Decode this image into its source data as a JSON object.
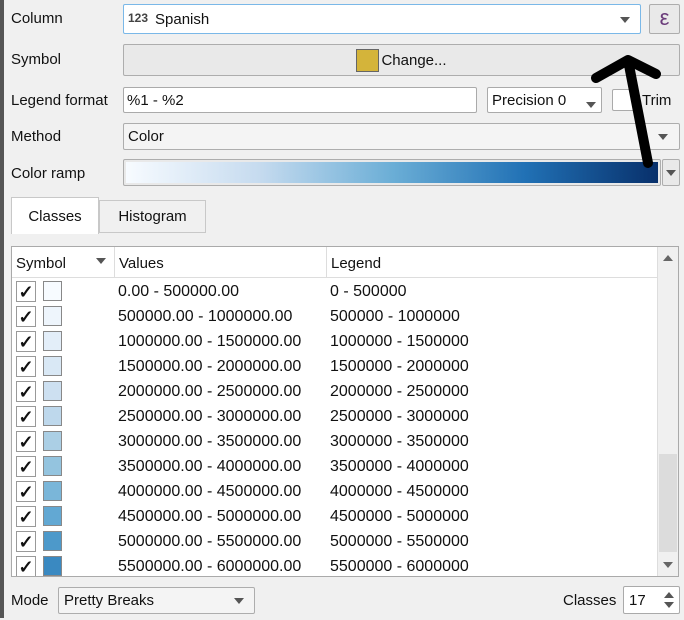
{
  "form": {
    "column_label": "Column",
    "column_type": "123",
    "column_value": "Spanish",
    "symbol_label": "Symbol",
    "symbol_button": "Change...",
    "symbol_color": "#d4b43a",
    "legend_format_label": "Legend format",
    "legend_format_value": "%1 - %2",
    "precision": "Precision 0",
    "trim_label": "Trim",
    "method_label": "Method",
    "method_value": "Color",
    "color_ramp_label": "Color ramp",
    "color_ramp_colors": [
      "#f7fbff",
      "#c6dbef",
      "#6baed6",
      "#2171b5",
      "#08306b"
    ],
    "expression_icon": "ε"
  },
  "tabs": [
    {
      "label": "Classes",
      "active": true
    },
    {
      "label": "Histogram",
      "active": false
    }
  ],
  "table": {
    "headers": [
      "Symbol",
      "Values",
      "Legend"
    ],
    "rows": [
      {
        "checked": true,
        "color": "#f7fbff",
        "values": "0.00 - 500000.00",
        "legend": "0 - 500000"
      },
      {
        "checked": true,
        "color": "#eef5fc",
        "values": "500000.00 - 1000000.00",
        "legend": "500000 - 1000000"
      },
      {
        "checked": true,
        "color": "#e3eef9",
        "values": "1000000.00 - 1500000.00",
        "legend": "1000000 - 1500000"
      },
      {
        "checked": true,
        "color": "#d9e8f5",
        "values": "1500000.00 - 2000000.00",
        "legend": "1500000 - 2000000"
      },
      {
        "checked": true,
        "color": "#cde0f1",
        "values": "2000000.00 - 2500000.00",
        "legend": "2000000 - 2500000"
      },
      {
        "checked": true,
        "color": "#bed8ec",
        "values": "2500000.00 - 3000000.00",
        "legend": "2500000 - 3000000"
      },
      {
        "checked": true,
        "color": "#abcfe5",
        "values": "3000000.00 - 3500000.00",
        "legend": "3000000 - 3500000"
      },
      {
        "checked": true,
        "color": "#94c4df",
        "values": "3500000.00 - 4000000.00",
        "legend": "3500000 - 4000000"
      },
      {
        "checked": true,
        "color": "#7ab6d9",
        "values": "4000000.00 - 4500000.00",
        "legend": "4000000 - 4500000"
      },
      {
        "checked": true,
        "color": "#62a8d3",
        "values": "4500000.00 - 5000000.00",
        "legend": "4500000 - 5000000"
      },
      {
        "checked": true,
        "color": "#4d99ca",
        "values": "5000000.00 - 5500000.00",
        "legend": "5000000 - 5500000"
      },
      {
        "checked": true,
        "color": "#3a89c1",
        "values": "5500000.00 - 6000000.00",
        "legend": "5500000 - 6000000"
      }
    ]
  },
  "footer": {
    "mode_label": "Mode",
    "mode_value": "Pretty Breaks",
    "classes_label": "Classes",
    "classes_value": "17"
  }
}
